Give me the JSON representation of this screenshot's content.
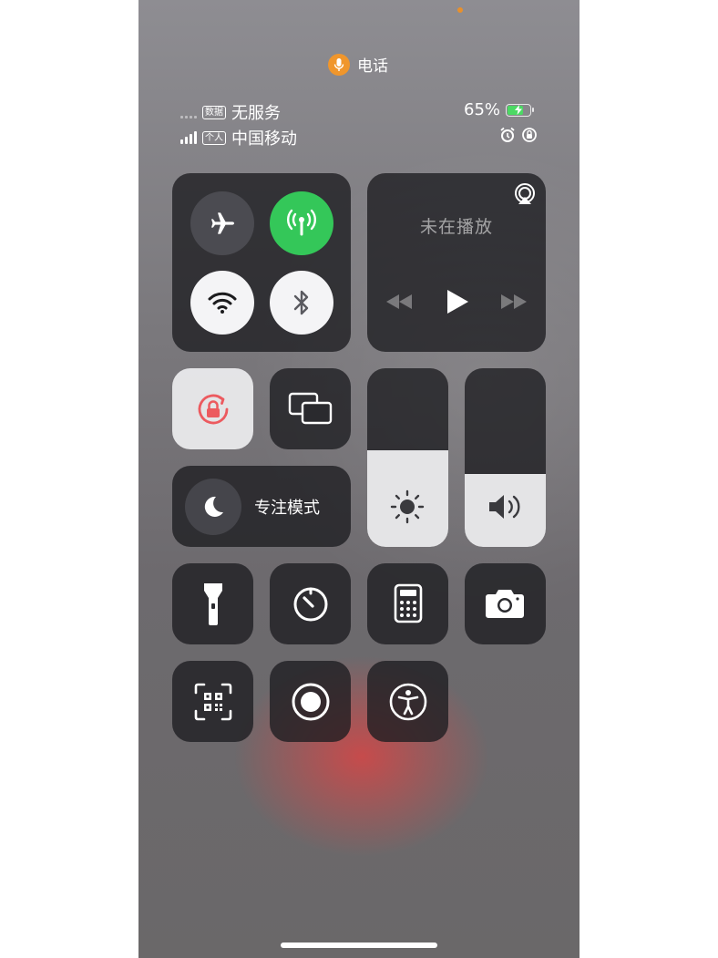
{
  "call": {
    "label": "电话",
    "accent": "#f0962c"
  },
  "status_left": {
    "sim1": {
      "tag": "数据",
      "carrier": "无服务"
    },
    "sim2": {
      "tag": "个人",
      "carrier": "中国移动"
    }
  },
  "status_right": {
    "battery": "65%",
    "battery_level": 0.65,
    "icons": [
      "alarm-icon",
      "orientation-lock-icon"
    ]
  },
  "connectivity": {
    "airplane": {
      "icon": "airplane-icon",
      "on": false
    },
    "cellular": {
      "icon": "cellular-antenna-icon",
      "on": true,
      "color": "#34c759"
    },
    "wifi": {
      "icon": "wifi-icon",
      "on": true
    },
    "bluetooth": {
      "icon": "bluetooth-icon",
      "on": true
    }
  },
  "now_playing": {
    "label": "未在播放",
    "icons": [
      "airplay-icon",
      "rewind-icon",
      "play-icon",
      "fast-forward-icon"
    ]
  },
  "controls": {
    "orientation_lock": {
      "icon": "orientation-lock-icon",
      "on": true,
      "color": "#ec5a5f"
    },
    "screen_mirroring": {
      "icon": "screen-mirroring-icon"
    },
    "focus": {
      "label": "专注模式",
      "icon": "moon-icon"
    },
    "brightness": {
      "icon": "sun-icon",
      "level": 0.54
    },
    "volume": {
      "icon": "speaker-icon",
      "level": 0.41
    }
  },
  "shortcuts": [
    "flashlight-icon",
    "timer-icon",
    "calculator-icon",
    "camera-icon",
    "qr-code-scanner-icon",
    "screen-recording-icon",
    "accessibility-icon"
  ]
}
